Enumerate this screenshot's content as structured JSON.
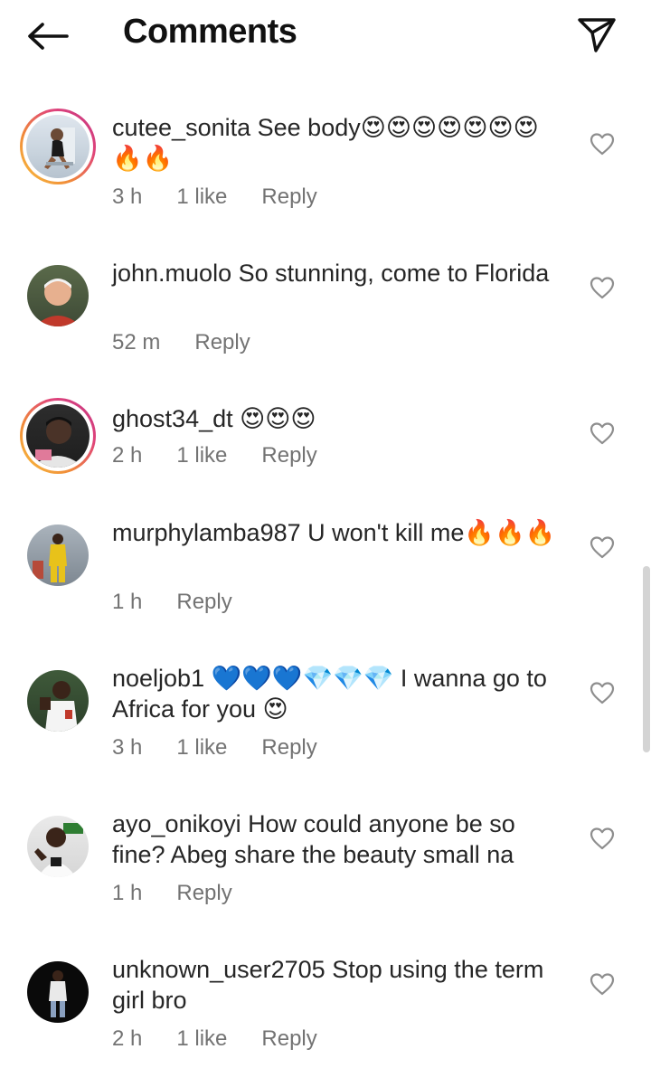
{
  "header": {
    "title": "Comments",
    "back_icon": "arrow-left-icon",
    "send_icon": "paper-plane-icon"
  },
  "comments": [
    {
      "username": "cutee_sonita",
      "text": "See body😍😍😍😍😍😍😍🔥🔥",
      "time": "3 h",
      "likes": "1 like",
      "reply": "Reply"
    },
    {
      "username": "john.muolo",
      "text": "So stunning, come to Florida",
      "time": "52 m",
      "likes": "",
      "reply": "Reply"
    },
    {
      "username": "ghost34_dt",
      "text": "😍😍😍",
      "time": "2 h",
      "likes": "1 like",
      "reply": "Reply"
    },
    {
      "username": "murphylamba987",
      "text": "U won't kill me🔥🔥🔥",
      "time": "1 h",
      "likes": "",
      "reply": "Reply"
    },
    {
      "username": "noeljob1",
      "text": "💙💙💙💎💎💎 I wanna go to Africa for you 😍",
      "time": "3 h",
      "likes": "1 like",
      "reply": "Reply"
    },
    {
      "username": "ayo_onikoyi",
      "text": "How could anyone be so fine? Abeg share the beauty small na",
      "time": "1 h",
      "likes": "",
      "reply": "Reply"
    },
    {
      "username": "unknown_user2705",
      "text": "Stop using the term girl bro",
      "time": "2 h",
      "likes": "1 like",
      "reply": "Reply"
    }
  ]
}
